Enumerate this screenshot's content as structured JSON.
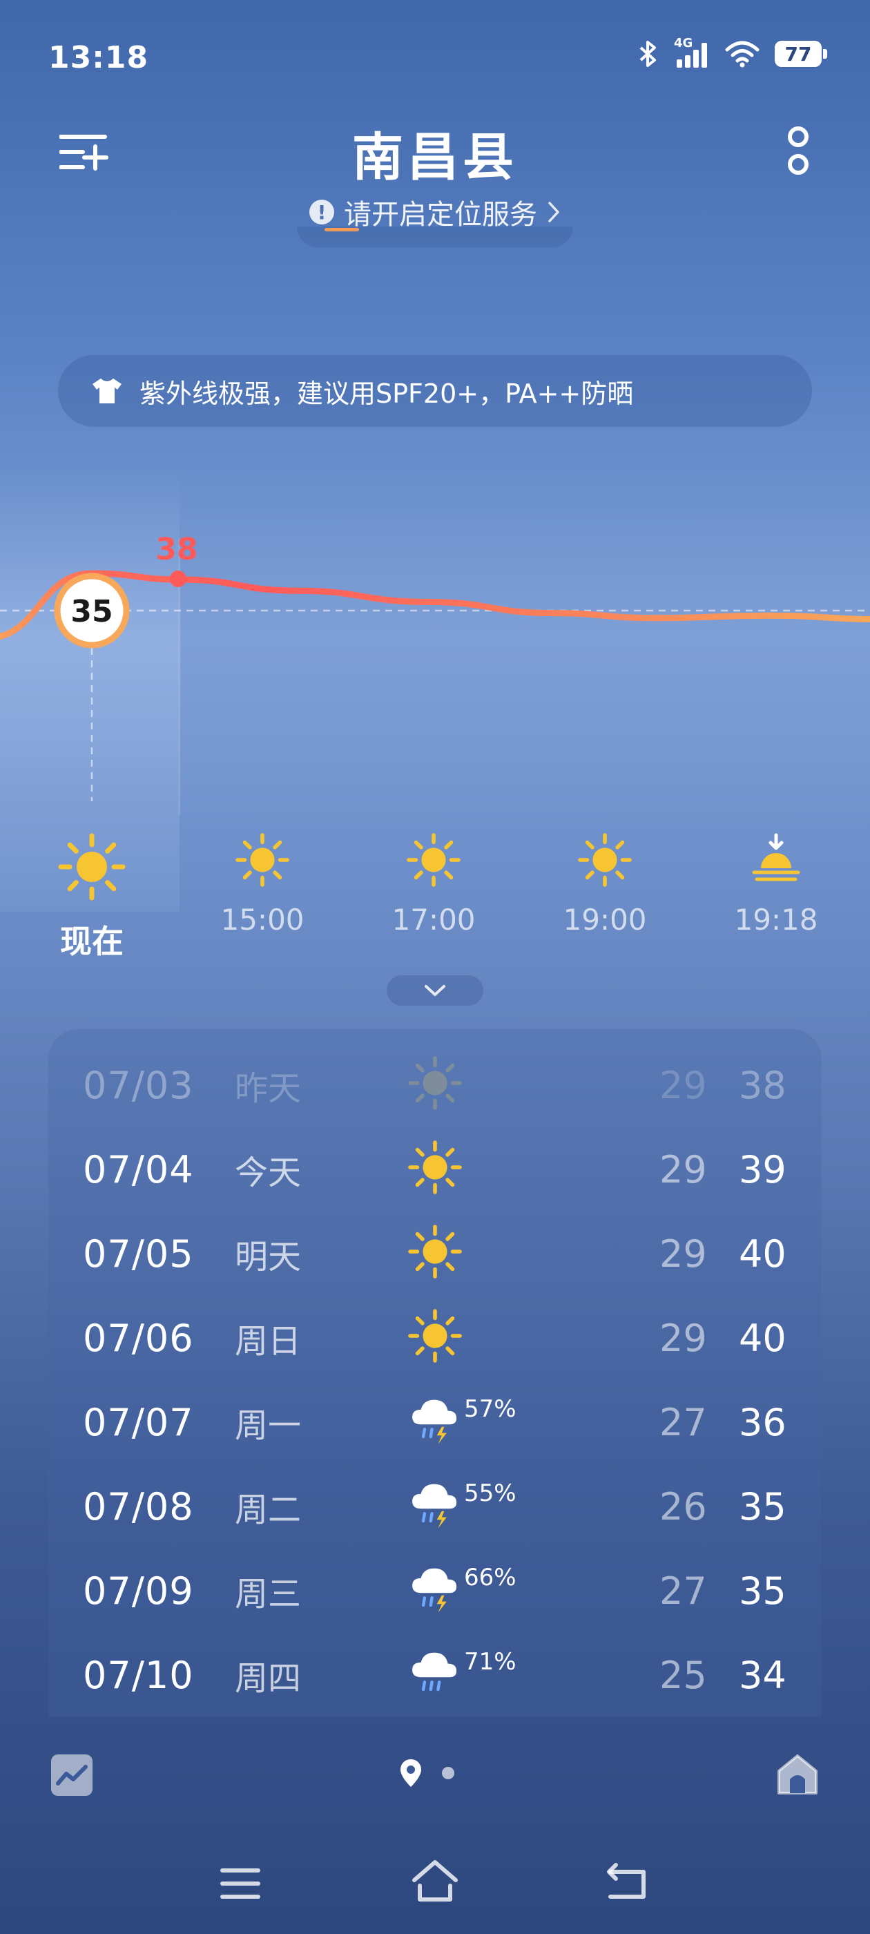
{
  "status_bar": {
    "time": "13:18",
    "network": "4G",
    "battery": "77"
  },
  "header": {
    "city": "南昌县",
    "location_hint": "请开启定位服务"
  },
  "uv_banner": {
    "text": "紫外线极强，建议用SPF20+，PA++防晒"
  },
  "chart_data": {
    "type": "line",
    "current_temp": "35",
    "peak_label": "38",
    "values": [
      35,
      38,
      37.5,
      36.6,
      35.7,
      34.8,
      34.4,
      34.6,
      34.3
    ],
    "colors": {
      "line_start": "#ff5a5a",
      "line_end": "#f7a85a",
      "current_ring": "#f7a85a"
    }
  },
  "hourly": [
    {
      "label": "现在",
      "icon": "sun-icon"
    },
    {
      "label": "15:00",
      "icon": "sun-icon"
    },
    {
      "label": "17:00",
      "icon": "sun-icon"
    },
    {
      "label": "19:00",
      "icon": "sun-icon"
    },
    {
      "label": "19:18",
      "icon": "sunset-icon"
    }
  ],
  "daily": [
    {
      "date": "07/03",
      "name": "昨天",
      "icon": "sun-icon",
      "rain": "",
      "low": "29",
      "high": "38",
      "past": true
    },
    {
      "date": "07/04",
      "name": "今天",
      "icon": "sun-icon",
      "rain": "",
      "low": "29",
      "high": "39"
    },
    {
      "date": "07/05",
      "name": "明天",
      "icon": "sun-icon",
      "rain": "",
      "low": "29",
      "high": "40"
    },
    {
      "date": "07/06",
      "name": "周日",
      "icon": "sun-icon",
      "rain": "",
      "low": "29",
      "high": "40"
    },
    {
      "date": "07/07",
      "name": "周一",
      "icon": "thunderstorm-icon",
      "rain": "57%",
      "low": "27",
      "high": "36"
    },
    {
      "date": "07/08",
      "name": "周二",
      "icon": "thunderstorm-icon",
      "rain": "55%",
      "low": "26",
      "high": "35"
    },
    {
      "date": "07/09",
      "name": "周三",
      "icon": "thunderstorm-icon",
      "rain": "66%",
      "low": "27",
      "high": "35"
    },
    {
      "date": "07/10",
      "name": "周四",
      "icon": "rain-icon",
      "rain": "71%",
      "low": "25",
      "high": "34"
    }
  ],
  "theme": {
    "sun": "#f7c531",
    "accent": "#f29a55"
  }
}
